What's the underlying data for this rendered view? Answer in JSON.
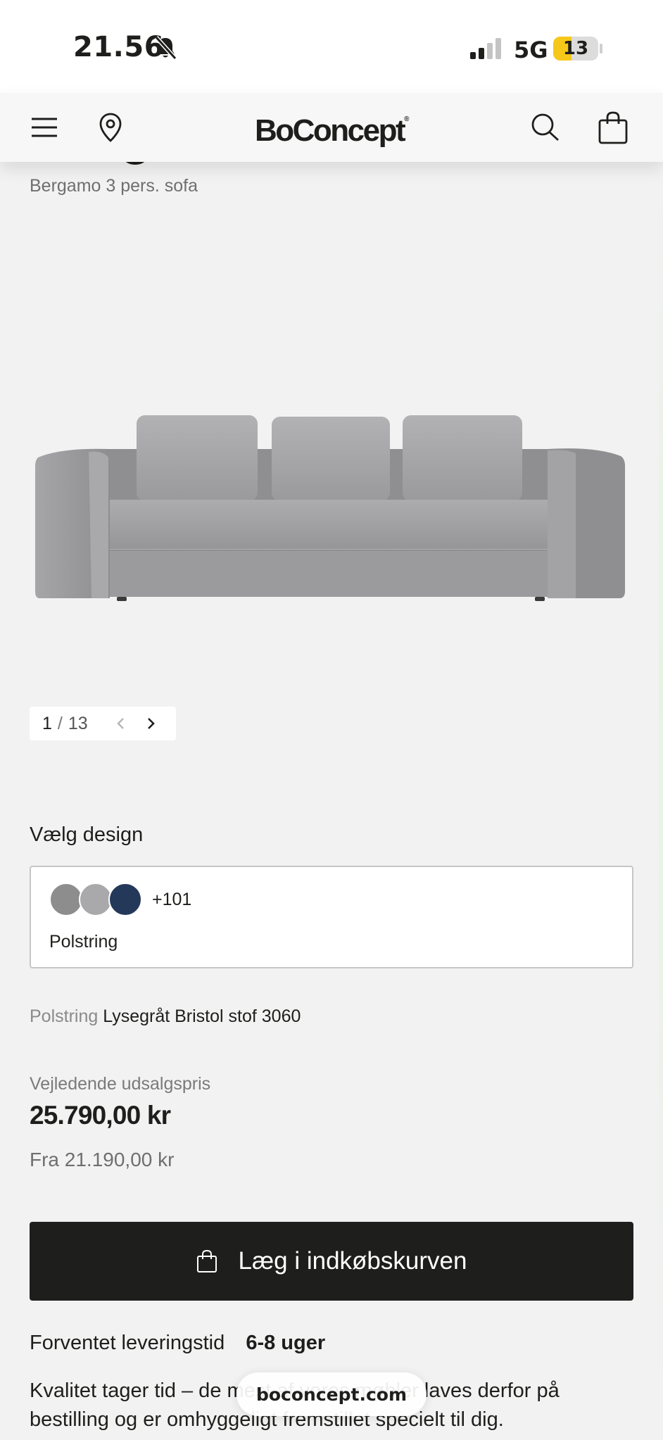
{
  "status_bar": {
    "time": "21.56",
    "network": "5G",
    "battery_level": "13",
    "battery_fraction": 0.13,
    "icons": [
      "bell-slash-icon",
      "signal-icon",
      "battery-icon"
    ]
  },
  "header": {
    "logo": "BoConcept",
    "logo_mark": "®",
    "icons": [
      "menu-icon",
      "location-pin-icon",
      "search-icon",
      "shopping-bag-icon"
    ]
  },
  "product": {
    "subtitle": "Bergamo 3 pers. sofa",
    "gallery": {
      "current": "1",
      "separator": "/",
      "total": "13"
    }
  },
  "design": {
    "label": "Vælg design",
    "swatch_colors": [
      "#8d8d8d",
      "#a9a9ab",
      "#24385a"
    ],
    "more_count": "+101",
    "type": "Polstring"
  },
  "upholstery": {
    "label": "Polstring",
    "value": "Lysegråt Bristol stof 3060"
  },
  "pricing": {
    "label": "Vejledende udsalgspris",
    "price": "25.790,00 kr",
    "from": "Fra 21.190,00 kr"
  },
  "cart": {
    "button_label": "Læg i indkøbskurven"
  },
  "delivery": {
    "label": "Forventet leveringstid",
    "value": "6-8 uger",
    "quality_text": "Kvalitet tager tid – de mest af vores møbler laves derfor på bestilling og er omhyggeligt fremstillet specielt til dig."
  },
  "browser": {
    "url": "boconcept.com"
  },
  "colors": {
    "text": "#1e1e1c",
    "background": "#f2f2f2",
    "button": "#1e1e1c",
    "battery": "#f6c819"
  }
}
